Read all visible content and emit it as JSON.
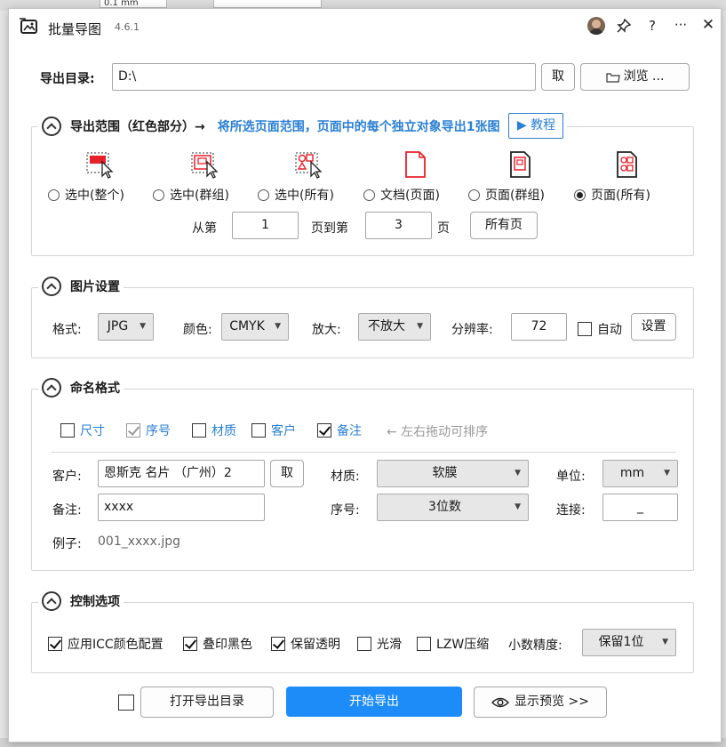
{
  "window": {
    "title": "批量导图",
    "version": "4.6.1"
  },
  "titlebar": {
    "help_label": "?",
    "more_label": "···",
    "close_label": "✕"
  },
  "background": {
    "field1": "0.1 mm"
  },
  "export_dir": {
    "label": "导出目录:",
    "value": "D:\\",
    "pick_label": "取",
    "browse_label": "浏览 ..."
  },
  "range": {
    "title": "导出范围（红色部分）→",
    "hint": "将所选页面范围，页面中的每个独立对象导出1张图",
    "tutorial_label": "▶ 教程",
    "options": [
      {
        "label": "选中(整个)",
        "selected": false,
        "icon": "selection-whole-icon"
      },
      {
        "label": "选中(群组)",
        "selected": false,
        "icon": "selection-group-icon"
      },
      {
        "label": "选中(所有)",
        "selected": false,
        "icon": "selection-all-icon"
      },
      {
        "label": "文档(页面)",
        "selected": false,
        "icon": "document-page-icon"
      },
      {
        "label": "页面(群组)",
        "selected": false,
        "icon": "page-group-icon"
      },
      {
        "label": "页面(所有)",
        "selected": true,
        "icon": "page-all-icon"
      }
    ],
    "from_label": "从第",
    "from_value": "1",
    "to_label": "页到第",
    "to_value": "3",
    "page_suffix": "页",
    "all_pages_label": "所有页"
  },
  "image": {
    "title": "图片设置",
    "format_label": "格式:",
    "format_value": "JPG",
    "color_label": "颜色:",
    "color_value": "CMYK",
    "zoom_label": "放大:",
    "zoom_value": "不放大",
    "dpi_label": "分辨率:",
    "dpi_value": "72",
    "auto_label": "自动",
    "auto_checked": false,
    "settings_label": "设置"
  },
  "naming": {
    "title": "命名格式",
    "fields": [
      {
        "label": "尺寸",
        "checked": false,
        "dim": false
      },
      {
        "label": "序号",
        "checked": true,
        "dim": true
      },
      {
        "label": "材质",
        "checked": false,
        "dim": false
      },
      {
        "label": "客户",
        "checked": false,
        "dim": false
      },
      {
        "label": "备注",
        "checked": true,
        "dim": false
      }
    ],
    "drag_hint": "← 左右拖动可排序",
    "customer_label": "客户:",
    "customer_value": "恩斯克 名片 （广州）2",
    "customer_pick_label": "取",
    "material_label": "材质:",
    "material_value": "软膜",
    "unit_label": "单位:",
    "unit_value": "mm",
    "note_label": "备注:",
    "note_value": "xxxx",
    "seq_label": "序号:",
    "seq_value": "3位数",
    "join_label": "连接:",
    "join_value": "_",
    "example_label": "例子:",
    "example_value": "001_xxxx.jpg"
  },
  "control": {
    "title": "控制选项",
    "options": [
      {
        "label": "应用ICC颜色配置",
        "checked": true
      },
      {
        "label": "叠印黑色",
        "checked": true
      },
      {
        "label": "保留透明",
        "checked": true
      },
      {
        "label": "光滑",
        "checked": false
      },
      {
        "label": "LZW压缩",
        "checked": false
      }
    ],
    "precision_label": "小数精度:",
    "precision_value": "保留1位"
  },
  "footer": {
    "open_checked": false,
    "open_dir_label": "打开导出目录",
    "start_label": "开始导出",
    "preview_label": "显示预览 >>"
  },
  "colors": {
    "accent": "#1e8cf8",
    "link": "#2a7fd4",
    "icon_red": "#e8202a"
  }
}
